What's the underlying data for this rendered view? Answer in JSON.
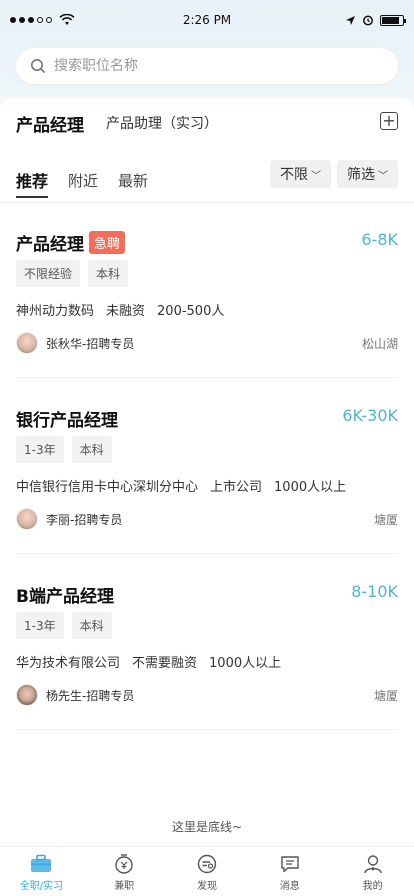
{
  "status_bar": {
    "time": "2:26 PM"
  },
  "search": {
    "placeholder": "搜索职位名称"
  },
  "job_tabs": {
    "active": "产品经理",
    "other": "产品助理（实习）"
  },
  "sort_tabs": [
    "推荐",
    "附近",
    "最新"
  ],
  "filters": {
    "range_label": "不限",
    "filter_label": "筛选"
  },
  "jobs": [
    {
      "title": "产品经理",
      "badge": "急聘",
      "salary": "6-8K",
      "tags": [
        "不限经验",
        "本科"
      ],
      "company": "神州动力数码",
      "funding": "未融资",
      "size": "200-500人",
      "recruiter": "张秋华-招聘专员",
      "location": "松山湖"
    },
    {
      "title": "银行产品经理",
      "salary": "6K-30K",
      "tags": [
        "1-3年",
        "本科"
      ],
      "company": "中信银行信用卡中心深圳分中心",
      "funding": "上市公司",
      "size": "1000人以上",
      "recruiter": "李丽-招聘专员",
      "location": "塘厦"
    },
    {
      "title": "B端产品经理",
      "salary": "8-10K",
      "tags": [
        "1-3年",
        "本科"
      ],
      "company": "华为技术有限公司",
      "funding": "不需要融资",
      "size": "1000人以上",
      "recruiter": "杨先生-招聘专员",
      "location": "塘厦"
    }
  ],
  "bottom_line": "这里是底线~",
  "tab_bar": [
    {
      "label": "全职/实习",
      "icon": "briefcase-icon",
      "active": true
    },
    {
      "label": "兼职",
      "icon": "coin-clock-icon"
    },
    {
      "label": "发现",
      "icon": "discover-icon"
    },
    {
      "label": "消息",
      "icon": "message-icon"
    },
    {
      "label": "我的",
      "icon": "profile-icon"
    }
  ],
  "colors": {
    "accent": "#4cb6d9",
    "urgent": "#f36d5a",
    "tab_active": "#3aa9da"
  }
}
